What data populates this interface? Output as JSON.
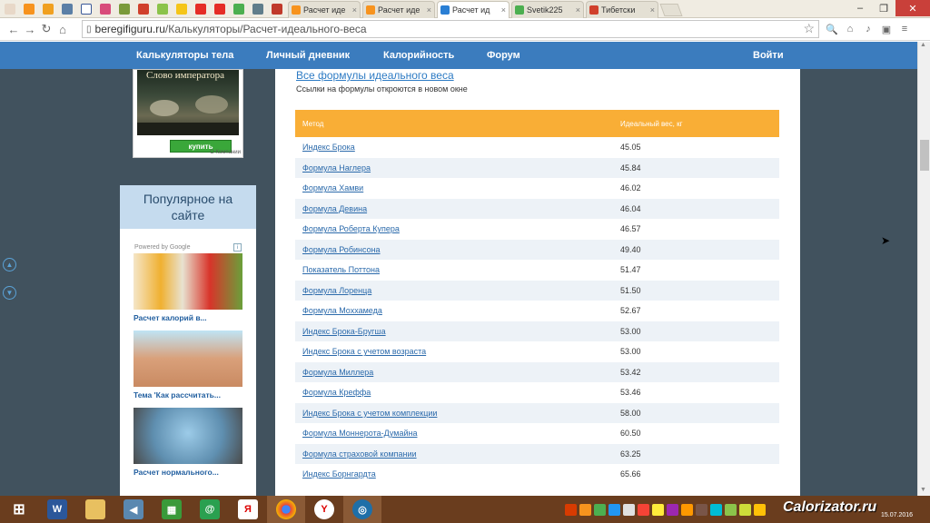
{
  "browser": {
    "tabs": [
      {
        "label": "Расчет иде",
        "color": "#f7931e"
      },
      {
        "label": "Расчет иде",
        "color": "#f7931e"
      },
      {
        "label": "Расчет ид",
        "color": "#2a7fd4",
        "active": true
      },
      {
        "label": "Svetik225",
        "color": "#4caf50"
      },
      {
        "label": "Тибетски",
        "color": "#d0402c"
      }
    ],
    "address": {
      "host": "beregifiguru.ru",
      "path": "/Калькуляторы/Расчет-идеального-веса"
    }
  },
  "sitenav": {
    "items": [
      "Калькуляторы тела",
      "Личный дневник",
      "Калорийность",
      "Форум"
    ],
    "login": "Войти"
  },
  "ad": {
    "book_title": "Слово императора",
    "buy_label": "купить",
    "note": "О Компании"
  },
  "popular": {
    "title_line1": "Популярное на",
    "title_line2": "сайте",
    "powered": "Powered by Google",
    "items": [
      {
        "title": "Расчет калорий в..."
      },
      {
        "title": "Тема 'Как рассчитать..."
      },
      {
        "title": "Расчет нормального..."
      }
    ]
  },
  "content": {
    "link_all": "Все формулы идеального веса",
    "note": "Ссылки на формулы откроются в новом окне",
    "table": {
      "headers": [
        "Метод",
        "Идеальный вес, кг"
      ],
      "rows": [
        {
          "method": "Индекс Брока",
          "value": "45.05"
        },
        {
          "method": "Формула Наглера",
          "value": "45.84"
        },
        {
          "method": "Формула Хамви",
          "value": "46.02"
        },
        {
          "method": "Формула Девина",
          "value": "46.04"
        },
        {
          "method": "Формула Роберта Купера",
          "value": "46.57"
        },
        {
          "method": "Формула Робинсона",
          "value": "49.40"
        },
        {
          "method": "Показатель Поттона",
          "value": "51.47"
        },
        {
          "method": "Формула Лоренца",
          "value": "51.50"
        },
        {
          "method": "Формула Моххамеда",
          "value": "52.67"
        },
        {
          "method": "Индекс Брока-Бругша",
          "value": "53.00"
        },
        {
          "method": "Индекс Брока с учетом возраста",
          "value": "53.00"
        },
        {
          "method": "Формула Миллера",
          "value": "53.42"
        },
        {
          "method": "Формула Креффа",
          "value": "53.46"
        },
        {
          "method": "Индекс Брока с учетом комплекции",
          "value": "58.00"
        },
        {
          "method": "Формула Моннерота-Думайна",
          "value": "60.50"
        },
        {
          "method": "Формула страховой компании",
          "value": "63.25"
        },
        {
          "method": "Индекс Борнгардта",
          "value": "65.66"
        }
      ]
    }
  },
  "taskbar": {
    "watermark": "Calorizator.ru",
    "date": "15.07.2016"
  },
  "colors": {
    "nav": "#3b7cbe",
    "table_header": "#f9ae36",
    "page_bg": "#41525e",
    "link": "#2b6aab"
  }
}
